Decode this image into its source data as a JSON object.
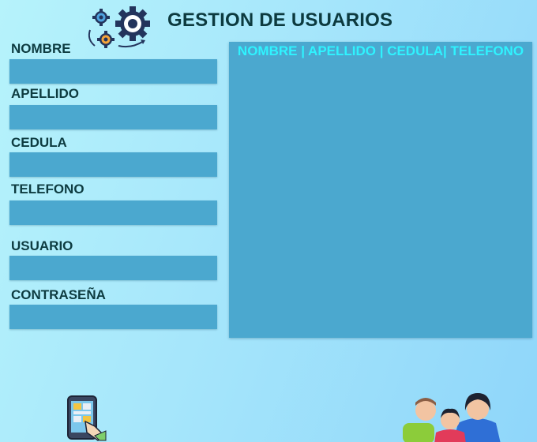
{
  "header": {
    "title": "GESTION DE USUARIOS",
    "icon": "gears-icon"
  },
  "form": {
    "nombre_label": "NOMBRE",
    "apellido_label": "APELLIDO",
    "cedula_label": "CEDULA",
    "telefono_label": "TELEFONO",
    "usuario_label": "USUARIO",
    "contrasena_label": "CONTRASEÑA",
    "nombre_value": "",
    "apellido_value": "",
    "cedula_value": "",
    "telefono_value": "",
    "usuario_value": "",
    "contrasena_value": ""
  },
  "list_panel": {
    "header": "NOMBRE | APELLIDO | CEDULA| TELEFONO"
  },
  "decor": {
    "phone": "mobile-phone-icon",
    "people": "users-group-icon"
  },
  "colors": {
    "field_bg": "#4ba8cf",
    "header_text": "#2ff3ff",
    "label_text": "#0d3b40"
  }
}
